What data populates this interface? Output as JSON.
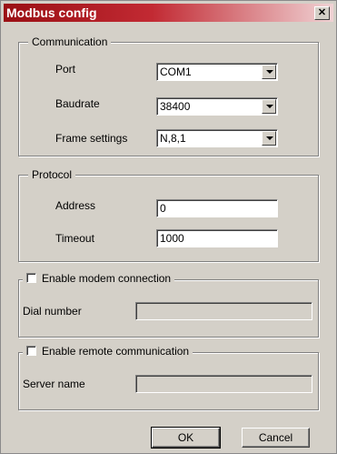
{
  "window": {
    "title": "Modbus config",
    "close_glyph": "✕"
  },
  "communication": {
    "legend": "Communication",
    "port_label": "Port",
    "port_value": "COM1",
    "baudrate_label": "Baudrate",
    "baudrate_value": "38400",
    "frame_label": "Frame settings",
    "frame_value": "N,8,1"
  },
  "protocol": {
    "legend": "Protocol",
    "address_label": "Address",
    "address_value": "0",
    "timeout_label": "Timeout",
    "timeout_value": "1000"
  },
  "modem": {
    "checkbox_label": "Enable modem connection",
    "checked": false,
    "dial_label": "Dial number",
    "dial_value": ""
  },
  "remote": {
    "checkbox_label": "Enable remote communication",
    "checked": false,
    "server_label": "Server name",
    "server_value": ""
  },
  "buttons": {
    "ok": "OK",
    "cancel": "Cancel"
  },
  "colors": {
    "title_start": "#9a0f14",
    "title_end": "#f0d2d4",
    "face": "#d4d0c8"
  }
}
